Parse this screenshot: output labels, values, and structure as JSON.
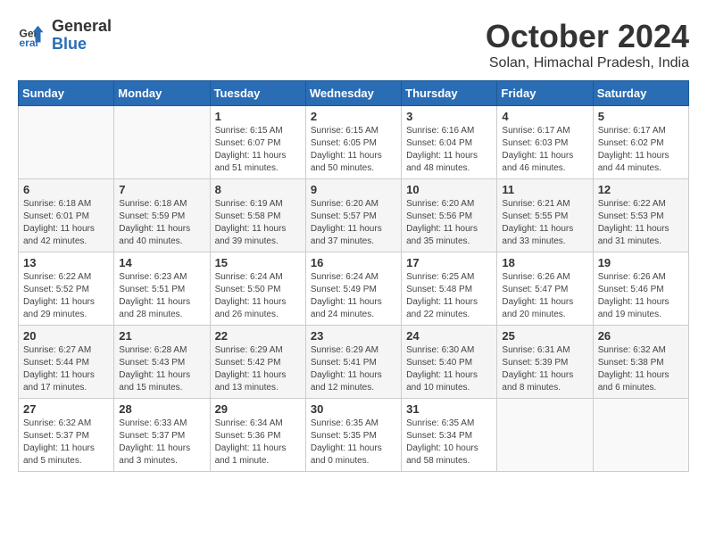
{
  "logo": {
    "line1": "General",
    "line2": "Blue"
  },
  "title": "October 2024",
  "subtitle": "Solan, Himachal Pradesh, India",
  "weekdays": [
    "Sunday",
    "Monday",
    "Tuesday",
    "Wednesday",
    "Thursday",
    "Friday",
    "Saturday"
  ],
  "weeks": [
    [
      {
        "day": "",
        "empty": true
      },
      {
        "day": "",
        "empty": true
      },
      {
        "day": "1",
        "sunrise": "6:15 AM",
        "sunset": "6:07 PM",
        "daylight": "11 hours and 51 minutes."
      },
      {
        "day": "2",
        "sunrise": "6:15 AM",
        "sunset": "6:05 PM",
        "daylight": "11 hours and 50 minutes."
      },
      {
        "day": "3",
        "sunrise": "6:16 AM",
        "sunset": "6:04 PM",
        "daylight": "11 hours and 48 minutes."
      },
      {
        "day": "4",
        "sunrise": "6:17 AM",
        "sunset": "6:03 PM",
        "daylight": "11 hours and 46 minutes."
      },
      {
        "day": "5",
        "sunrise": "6:17 AM",
        "sunset": "6:02 PM",
        "daylight": "11 hours and 44 minutes."
      }
    ],
    [
      {
        "day": "6",
        "sunrise": "6:18 AM",
        "sunset": "6:01 PM",
        "daylight": "11 hours and 42 minutes."
      },
      {
        "day": "7",
        "sunrise": "6:18 AM",
        "sunset": "5:59 PM",
        "daylight": "11 hours and 40 minutes."
      },
      {
        "day": "8",
        "sunrise": "6:19 AM",
        "sunset": "5:58 PM",
        "daylight": "11 hours and 39 minutes."
      },
      {
        "day": "9",
        "sunrise": "6:20 AM",
        "sunset": "5:57 PM",
        "daylight": "11 hours and 37 minutes."
      },
      {
        "day": "10",
        "sunrise": "6:20 AM",
        "sunset": "5:56 PM",
        "daylight": "11 hours and 35 minutes."
      },
      {
        "day": "11",
        "sunrise": "6:21 AM",
        "sunset": "5:55 PM",
        "daylight": "11 hours and 33 minutes."
      },
      {
        "day": "12",
        "sunrise": "6:22 AM",
        "sunset": "5:53 PM",
        "daylight": "11 hours and 31 minutes."
      }
    ],
    [
      {
        "day": "13",
        "sunrise": "6:22 AM",
        "sunset": "5:52 PM",
        "daylight": "11 hours and 29 minutes."
      },
      {
        "day": "14",
        "sunrise": "6:23 AM",
        "sunset": "5:51 PM",
        "daylight": "11 hours and 28 minutes."
      },
      {
        "day": "15",
        "sunrise": "6:24 AM",
        "sunset": "5:50 PM",
        "daylight": "11 hours and 26 minutes."
      },
      {
        "day": "16",
        "sunrise": "6:24 AM",
        "sunset": "5:49 PM",
        "daylight": "11 hours and 24 minutes."
      },
      {
        "day": "17",
        "sunrise": "6:25 AM",
        "sunset": "5:48 PM",
        "daylight": "11 hours and 22 minutes."
      },
      {
        "day": "18",
        "sunrise": "6:26 AM",
        "sunset": "5:47 PM",
        "daylight": "11 hours and 20 minutes."
      },
      {
        "day": "19",
        "sunrise": "6:26 AM",
        "sunset": "5:46 PM",
        "daylight": "11 hours and 19 minutes."
      }
    ],
    [
      {
        "day": "20",
        "sunrise": "6:27 AM",
        "sunset": "5:44 PM",
        "daylight": "11 hours and 17 minutes."
      },
      {
        "day": "21",
        "sunrise": "6:28 AM",
        "sunset": "5:43 PM",
        "daylight": "11 hours and 15 minutes."
      },
      {
        "day": "22",
        "sunrise": "6:29 AM",
        "sunset": "5:42 PM",
        "daylight": "11 hours and 13 minutes."
      },
      {
        "day": "23",
        "sunrise": "6:29 AM",
        "sunset": "5:41 PM",
        "daylight": "11 hours and 12 minutes."
      },
      {
        "day": "24",
        "sunrise": "6:30 AM",
        "sunset": "5:40 PM",
        "daylight": "11 hours and 10 minutes."
      },
      {
        "day": "25",
        "sunrise": "6:31 AM",
        "sunset": "5:39 PM",
        "daylight": "11 hours and 8 minutes."
      },
      {
        "day": "26",
        "sunrise": "6:32 AM",
        "sunset": "5:38 PM",
        "daylight": "11 hours and 6 minutes."
      }
    ],
    [
      {
        "day": "27",
        "sunrise": "6:32 AM",
        "sunset": "5:37 PM",
        "daylight": "11 hours and 5 minutes."
      },
      {
        "day": "28",
        "sunrise": "6:33 AM",
        "sunset": "5:37 PM",
        "daylight": "11 hours and 3 minutes."
      },
      {
        "day": "29",
        "sunrise": "6:34 AM",
        "sunset": "5:36 PM",
        "daylight": "11 hours and 1 minute."
      },
      {
        "day": "30",
        "sunrise": "6:35 AM",
        "sunset": "5:35 PM",
        "daylight": "11 hours and 0 minutes."
      },
      {
        "day": "31",
        "sunrise": "6:35 AM",
        "sunset": "5:34 PM",
        "daylight": "10 hours and 58 minutes."
      },
      {
        "day": "",
        "empty": true
      },
      {
        "day": "",
        "empty": true
      }
    ]
  ]
}
